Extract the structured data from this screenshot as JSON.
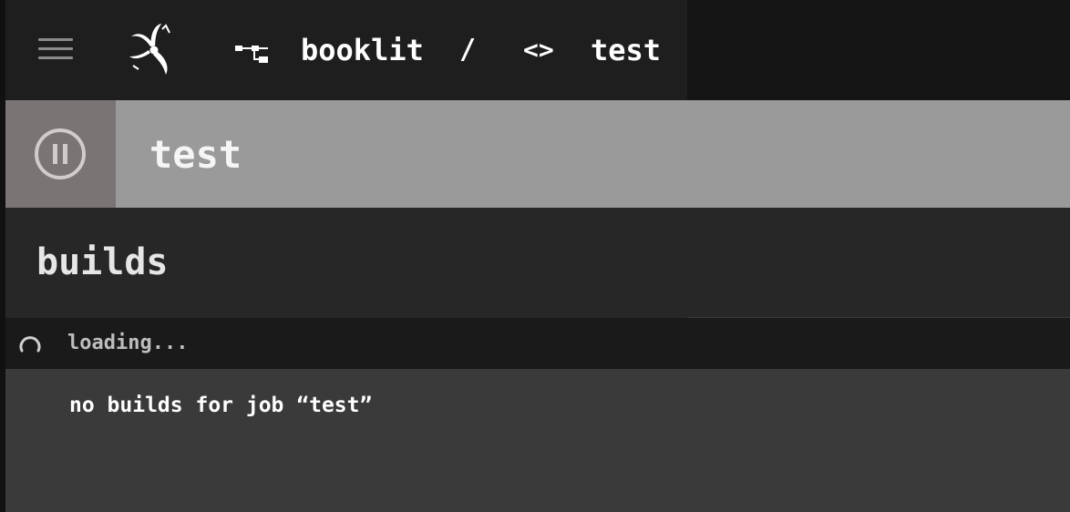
{
  "topbar": {
    "menu_icon": "hamburger-icon",
    "logo_icon": "concourse-logo",
    "pipeline_icon": "pipeline-icon",
    "pipeline_name": "booklit",
    "separator": "/",
    "job_icon_glyph": "<>",
    "job_name": "test"
  },
  "job_header": {
    "pause_icon": "pause-circle-icon",
    "title": "test",
    "colors": {
      "header_bg": "#9a9a9a",
      "toggle_bg": "#7a7474"
    }
  },
  "builds": {
    "heading": "builds",
    "loading_text": "loading...",
    "empty_message": "no builds for job “test”"
  }
}
